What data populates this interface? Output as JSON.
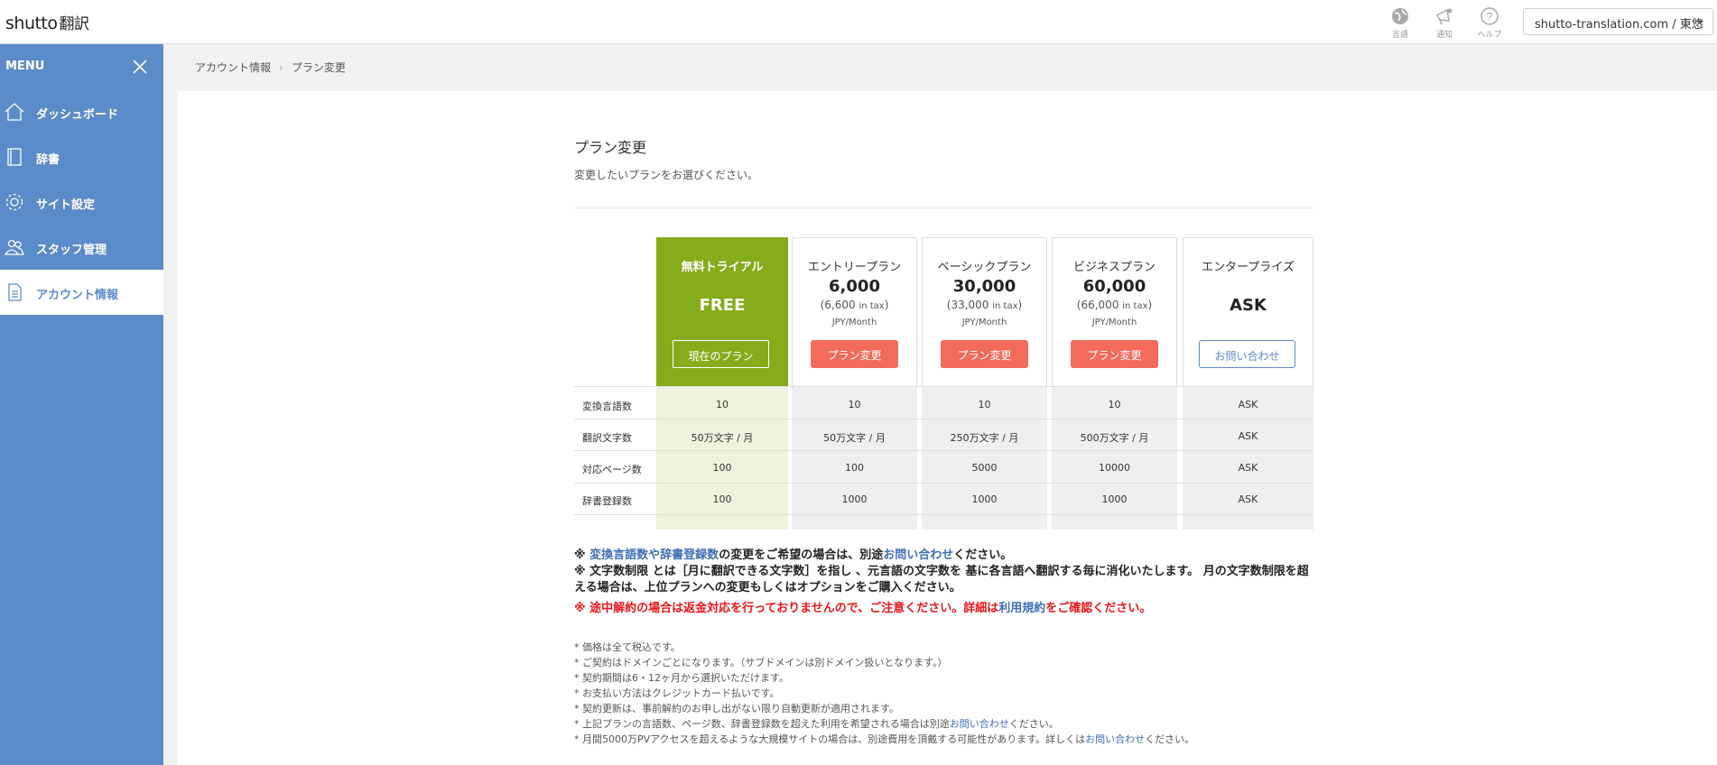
{
  "header": {
    "logo": "shutto",
    "logo_sub": "翻訳",
    "icons": [
      {
        "name": "globe-icon",
        "label": "言語"
      },
      {
        "name": "megaphone-icon",
        "label": "通知"
      },
      {
        "name": "help-icon",
        "label": "ヘルプ"
      }
    ],
    "domain_select": "shutto-translation.com / 東悠"
  },
  "sidebar": {
    "menu_title": "MENU",
    "items": [
      {
        "label": "ダッシュボード",
        "icon": "home-icon"
      },
      {
        "label": "辞書",
        "icon": "book-icon"
      },
      {
        "label": "サイト設定",
        "icon": "gear-icon"
      },
      {
        "label": "スタッフ管理",
        "icon": "staff-icon"
      },
      {
        "label": "アカウント情報",
        "icon": "document-icon",
        "active": true
      }
    ]
  },
  "breadcrumb": [
    "アカウント情報",
    "プラン変更"
  ],
  "page": {
    "title": "プラン変更",
    "subtitle": "変更したいプランをお選びください。"
  },
  "plans": [
    {
      "name": "無料トライアル",
      "big": "FREE",
      "button": "現在のプラン"
    },
    {
      "name": "エントリープラン",
      "price": "6,000",
      "tax_pre": "(6,600 ",
      "tax_in": "in tax",
      "tax_post": ")",
      "unit": "JPY/Month",
      "button": "プラン変更"
    },
    {
      "name": "ベーシックプラン",
      "price": "30,000",
      "tax_pre": "(33,000 ",
      "tax_in": "in tax",
      "tax_post": ")",
      "unit": "JPY/Month",
      "button": "プラン変更"
    },
    {
      "name": "ビジネスプラン",
      "price": "60,000",
      "tax_pre": "(66,000 ",
      "tax_in": "in tax",
      "tax_post": ")",
      "unit": "JPY/Month",
      "button": "プラン変更"
    },
    {
      "name": "エンタープライズ",
      "big": "ASK",
      "button": "お問い合わせ"
    }
  ],
  "features": [
    {
      "label": "変換言語数",
      "values": [
        "10",
        "10",
        "10",
        "10",
        "ASK"
      ]
    },
    {
      "label": "翻訳文字数",
      "values": [
        "50万文字 / 月",
        "50万文字 / 月",
        "250万文字 / 月",
        "500万文字 / 月",
        "ASK"
      ]
    },
    {
      "label": "対応ページ数",
      "values": [
        "100",
        "100",
        "5000",
        "10000",
        "ASK"
      ]
    },
    {
      "label": "辞書登録数",
      "values": [
        "100",
        "1000",
        "1000",
        "1000",
        "ASK"
      ]
    }
  ],
  "notes": {
    "n1_pre": "※ ",
    "n1_link1": "変換言語数や辞書登録数",
    "n1_mid": "の変更をご希望の場合は、別途",
    "n1_link2": "お問い合わせ",
    "n1_post": "ください。",
    "n2": "※ 文字数制限 とは［月に翻訳できる文字数］を指し 、元言語の文字数を 基に各言語へ翻訳する毎に消化いたします。 月の文字数制限を超える場合は、上位プランへの変更もしくはオプションをご購入ください。",
    "n3_pre": "※ 途中解約の場合は返金対応を行っておりませんので、ご注意ください。詳細は",
    "n3_link": "利用規約",
    "n3_post": "をご確認ください。"
  },
  "fine_print": {
    "f1": "* 価格は全て税込です。",
    "f2": "* ご契約はドメインごとになります。（サブドメインは別ドメイン扱いとなります。）",
    "f3": "* 契約期間は6・12ヶ月から選択いただけます。",
    "f4": "* お支払い方法はクレジットカード払いです。",
    "f5": "* 契約更新は、事前解約のお申し出がない限り自動更新が適用されます。",
    "f6_pre": "* 上記プランの言語数、ページ数、辞書登録数を超えた利用を希望される場合は別途",
    "f6_link": "お問い合わせ",
    "f6_post": "ください。",
    "f7_pre": "* 月間5000万PVアクセスを超えるような大規模サイトの場合は、別途費用を頂戴する可能性があります。詳しくは",
    "f7_link": "お問い合わせ",
    "f7_post": "ください。"
  },
  "colors": {
    "sidebar": "#5b8bc9",
    "current_plan": "#85ac1b",
    "change_button": "#f26b5b",
    "link": "#3f6fb5",
    "warning": "#e8171b"
  }
}
